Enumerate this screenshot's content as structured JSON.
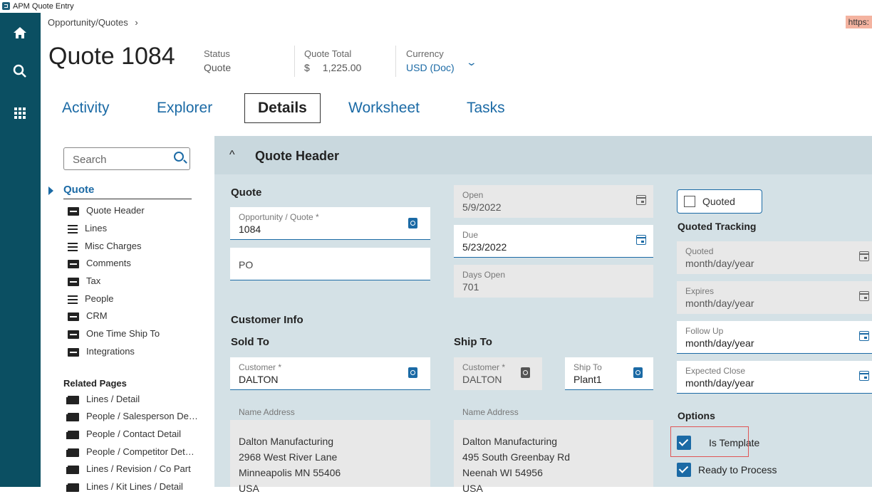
{
  "window": {
    "title": "APM Quote Entry",
    "url_fragment": "https:"
  },
  "nav": {
    "icons": [
      "home-icon",
      "search-icon",
      "apps-grid-icon"
    ]
  },
  "breadcrumb": {
    "text": "Opportunity/Quotes",
    "chevron": "›"
  },
  "header": {
    "title": "Quote 1084",
    "status_label": "Status",
    "status_value": "Quote",
    "total_label": "Quote Total",
    "total_currency_symbol": "$",
    "total_value": "1,225.00",
    "currency_label": "Currency",
    "currency_value": "USD (Doc)"
  },
  "tabs": [
    "Activity",
    "Explorer",
    "Details",
    "Worksheet",
    "Tasks"
  ],
  "active_tab": "Details",
  "sidebar": {
    "search_placeholder": "Search",
    "section": "Quote",
    "items": [
      {
        "label": "Quote Header",
        "icon": "card-icon"
      },
      {
        "label": "Lines",
        "icon": "list-icon"
      },
      {
        "label": "Misc Charges",
        "icon": "list-icon"
      },
      {
        "label": "Comments",
        "icon": "card-icon"
      },
      {
        "label": "Tax",
        "icon": "card-icon"
      },
      {
        "label": "People",
        "icon": "list-icon"
      },
      {
        "label": "CRM",
        "icon": "card-icon"
      },
      {
        "label": "One Time Ship To",
        "icon": "card-icon"
      },
      {
        "label": "Integrations",
        "icon": "card-icon"
      }
    ],
    "related_title": "Related Pages",
    "related": [
      "Lines / Detail",
      "People / Salesperson De…",
      "People / Contact Detail",
      "People / Competitor Det…",
      "Lines / Revision / Co Part",
      "Lines / Kit Lines / Detail"
    ]
  },
  "main": {
    "section_title": "Quote Header",
    "quote_label": "Quote",
    "opportunity_label": "Opportunity / Quote *",
    "opportunity_value": "1084",
    "po_label": "PO",
    "open_label": "Open",
    "open_value": "5/9/2022",
    "due_label": "Due",
    "due_value": "5/23/2022",
    "days_open_label": "Days Open",
    "days_open_value": "701",
    "customer_info_label": "Customer Info",
    "sold_to_label": "Sold To",
    "ship_to_section_label": "Ship To",
    "customer_label": "Customer *",
    "customer_value": "DALTON",
    "ship_customer_label": "Customer *",
    "ship_customer_value": "DALTON",
    "ship_to_label": "Ship To",
    "ship_to_value": "Plant1",
    "name_address_label": "Name Address",
    "sold_address": [
      "Dalton Manufacturing",
      "2968 West River Lane",
      "Minneapolis MN 55406",
      "USA"
    ],
    "ship_address": [
      "Dalton Manufacturing",
      "495 South Greenbay Rd",
      "Neenah WI 54956",
      "USA"
    ],
    "quoted_checkbox_label": "Quoted",
    "quoted_tracking_label": "Quoted Tracking",
    "quoted_date_label": "Quoted",
    "expires_label": "Expires",
    "follow_up_label": "Follow Up",
    "expected_close_label": "Expected Close",
    "date_placeholder": "month/day/year",
    "options_label": "Options",
    "is_template_label": "Is Template",
    "is_template_checked": true,
    "ready_label": "Ready to Process",
    "ready_checked": true
  }
}
